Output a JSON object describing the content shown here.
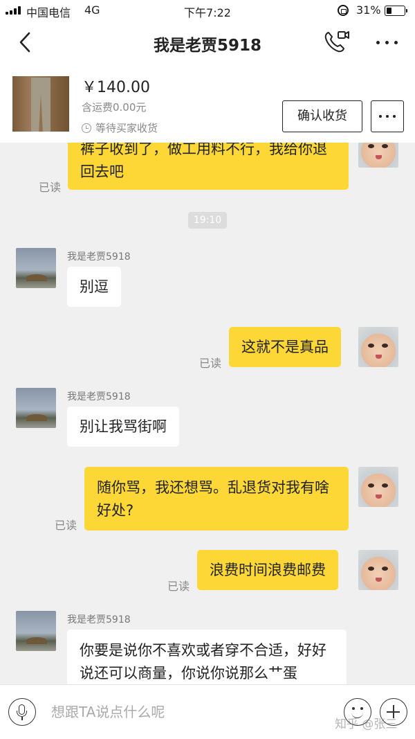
{
  "status_bar": {
    "carrier": "中国电信",
    "network": "4G",
    "time": "下午7:22",
    "battery_percent": "31%",
    "battery_level": 0.31
  },
  "nav": {
    "title": "我是老贾5918",
    "back_icon": "chevron-left-icon",
    "call_icon": "phone-video-icon",
    "more_icon": "more-dots-icon"
  },
  "order": {
    "price": "￥140.00",
    "shipping": "含运费0.00元",
    "status": "等待买家收货",
    "confirm_label": "确认收货",
    "more_icon": "more-dots-icon"
  },
  "chat": {
    "time_divider": "19:10",
    "messages": [
      {
        "from": "me",
        "text": "裤子收到了，做工用料不行，我给你退回去吧",
        "read": "已读"
      },
      {
        "from": "other",
        "sender": "我是老贾5918",
        "text": "别逗"
      },
      {
        "from": "me",
        "text": "这就不是真品",
        "read": "已读"
      },
      {
        "from": "other",
        "sender": "我是老贾5918",
        "text": "别让我骂街啊"
      },
      {
        "from": "me",
        "text": "随你骂，我还想骂。乱退货对我有啥好处?",
        "read": "已读"
      },
      {
        "from": "me",
        "text": "浪费时间浪费邮费",
        "read": "已读"
      },
      {
        "from": "other",
        "sender": "我是老贾5918",
        "text": "你要是说你不喜欢或者穿不合适，好好说还可以商量，你说你说那么艹蛋"
      }
    ]
  },
  "input_bar": {
    "placeholder": "想跟TA说点什么呢",
    "voice_icon": "microphone-icon",
    "emoji_icon": "smiley-icon",
    "plus_icon": "plus-icon",
    "watermark": "知乎 @张三"
  }
}
